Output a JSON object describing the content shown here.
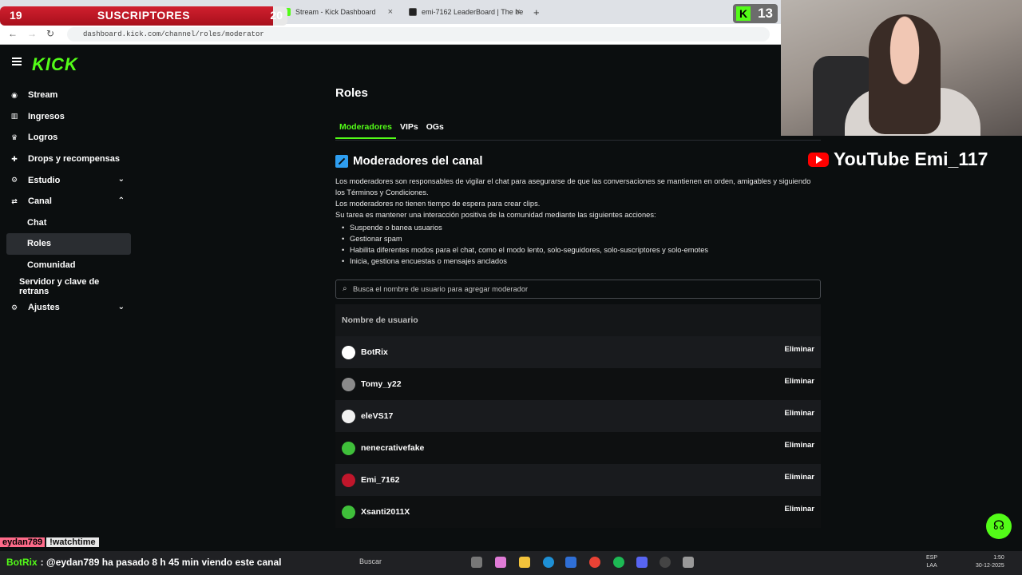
{
  "browser": {
    "tabs": [
      {
        "label": "Stream - Kick Dashboard"
      },
      {
        "label": "emi-7162 LeaderBoard | The be"
      }
    ],
    "new_tab_label": "+",
    "url": "dashboard.kick.com/channel/roles/moderator"
  },
  "overlay": {
    "subs_current": "19",
    "subs_label": "SUSCRIPTORES",
    "subs_goal": "20",
    "subs_progress": 0.95,
    "kick_count": "13",
    "youtube_text": "YouTube Emi_117"
  },
  "app": {
    "logo": "KICK",
    "sidebar": [
      {
        "label": "Stream",
        "icon": "broadcast-icon"
      },
      {
        "label": "Ingresos",
        "icon": "chart-icon"
      },
      {
        "label": "Logros",
        "icon": "trophy-icon"
      },
      {
        "label": "Drops y recompensas",
        "icon": "gift-icon"
      },
      {
        "label": "Estudio",
        "icon": "studio-icon",
        "chevron": "⌄"
      },
      {
        "label": "Canal",
        "icon": "channel-icon",
        "chevron": "⌃"
      },
      {
        "label": "Chat"
      },
      {
        "label": "Roles"
      },
      {
        "label": "Comunidad"
      },
      {
        "label": "Servidor y clave de retrans"
      },
      {
        "label": "Ajustes",
        "icon": "gear-icon",
        "chevron": "⌄"
      }
    ],
    "page_title": "Roles",
    "tabs": [
      "Moderadores",
      "VIPs",
      "OGs"
    ],
    "active_tab": "Moderadores",
    "section_title": "Moderadores del canal",
    "description": [
      "Los moderadores son responsables de vigilar el chat para asegurarse de que las conversaciones se mantienen en orden, amigables y siguiendo los Términos y Condiciones.",
      "Los moderadores no tienen tiempo de espera para crear clips.",
      "Su tarea es mantener una interacción positiva de la comunidad mediante las siguientes acciones:"
    ],
    "bullets": [
      "Suspende o banea usuarios",
      "Gestionar spam",
      "Habilita diferentes modos para el chat, como el modo lento, solo-seguidores, solo-suscriptores y solo-emotes",
      "Inicia, gestiona encuestas o mensajes anclados"
    ],
    "search_placeholder": "Busca el nombre de usuario para agregar moderador",
    "table_header": "Nombre de usuario",
    "remove_label": "Eliminar",
    "moderators": [
      {
        "name": "BotRix",
        "avatar_color": "#ffffff"
      },
      {
        "name": "Tomy_y22",
        "avatar_color": "#8a8a8a"
      },
      {
        "name": "eleVS17",
        "avatar_color": "#f0f0f0"
      },
      {
        "name": "nenecrativefake",
        "avatar_color": "#3fbf3a"
      },
      {
        "name": "Emi_7162",
        "avatar_color": "#c0162b"
      },
      {
        "name": "Xsanti2011X",
        "avatar_color": "#3fbf3a"
      }
    ]
  },
  "chat": {
    "top_user": "eydan789",
    "top_message": "!watchtime",
    "bottom_user": "BotRix",
    "bottom_message": ": @eydan789 ha pasado 8 h 45 min viendo este canal"
  },
  "taskbar": {
    "search_label": "Buscar",
    "lang_top": "ESP",
    "lang_bottom": "LAA",
    "time": "1:50",
    "date": "30-12-2025"
  },
  "colors": {
    "accent": "#53fc18",
    "bg": "#0b0e0f"
  }
}
